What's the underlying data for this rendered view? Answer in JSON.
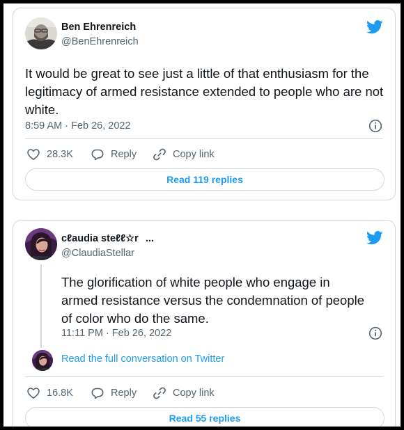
{
  "tweet1": {
    "author_name": "Ben Ehrenreich",
    "author_handle": "@BenEhrenreich",
    "text": "It would be great to see just a little of that enthusiasm for the legitimacy of armed resistance extended to people who are not white.",
    "timestamp": "8:59 AM · Feb 26, 2022",
    "like_count": "28.3K",
    "reply_label": "Reply",
    "copy_link_label": "Copy link",
    "read_replies_label": "Read 119 replies"
  },
  "tweet2": {
    "author_name": "cℓaudia steℓℓ☆r",
    "name_ellipsis": "...",
    "author_handle": "@ClaudiaStellar",
    "text": "The glorification of white people who engage in armed resistance versus the condemnation of people of color who do the same.",
    "timestamp": "11:11 PM · Feb 26, 2022",
    "full_conversation_label": "Read the full conversation on Twitter",
    "like_count": "16.8K",
    "reply_label": "Reply",
    "copy_link_label": "Copy link",
    "read_replies_label": "Read 55 replies"
  },
  "icons": {
    "brand": "twitter-bird-icon",
    "info": "info-icon",
    "like": "heart-icon",
    "reply": "speech-bubble-icon",
    "copy_link": "link-icon"
  },
  "colors": {
    "brand_blue": "#1d9bf0",
    "secondary_text": "#536471",
    "border": "#cfd9de",
    "frame_background": "#000000"
  }
}
